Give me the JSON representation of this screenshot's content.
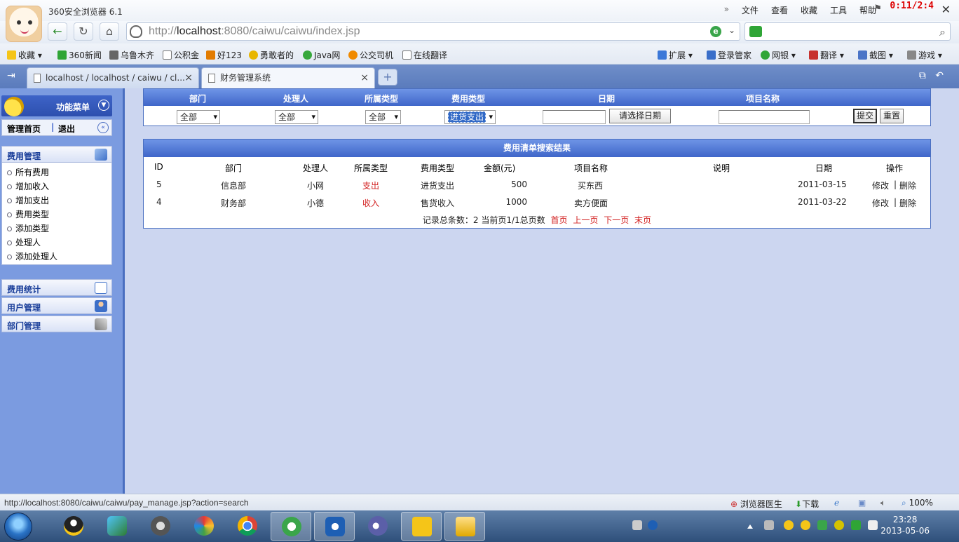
{
  "browser": {
    "app_title": "360安全浏览器 6.1",
    "menu": [
      "文件",
      "查看",
      "收藏",
      "工具",
      "帮助"
    ],
    "clock": "0:11/2:4",
    "url_prefix": "http://",
    "url_host": "localhost",
    "url_rest": ":8080/caiwu/caiwu/index.jsp",
    "favorites_left": [
      "收藏",
      "360新闻",
      "乌鲁木齐",
      "公积金",
      "好123",
      "勇敢者的",
      "Java网",
      "公交司机",
      "在线翻译"
    ],
    "favorites_right": [
      "扩展",
      "登录管家",
      "网银",
      "翻译",
      "截图",
      "游戏"
    ],
    "tabs": [
      {
        "label": "localhost / localhost / caiwu / cl..."
      },
      {
        "label": "财务管理系统"
      }
    ]
  },
  "sidebar": {
    "header": "功能菜单",
    "home": "管理首页",
    "separator": "|",
    "logout": "退出",
    "sections": [
      {
        "title": "费用管理",
        "items": [
          "所有费用",
          "增加收入",
          "增加支出",
          "费用类型",
          "添加类型",
          "处理人",
          "添加处理人"
        ]
      },
      {
        "title": "费用统计"
      },
      {
        "title": "用户管理"
      },
      {
        "title": "部门管理"
      }
    ]
  },
  "search": {
    "headers": [
      "部门",
      "处理人",
      "所属类型",
      "费用类型",
      "日期",
      "项目名称"
    ],
    "dept_value": "全部",
    "handler_value": "全部",
    "category_value": "全部",
    "fee_type_value": "进货支出",
    "date_button": "请选择日期",
    "submit": "提交",
    "reset": "重置"
  },
  "results": {
    "title": "费用清单搜索结果",
    "columns": [
      "ID",
      "部门",
      "处理人",
      "所属类型",
      "费用类型",
      "金额(元)",
      "项目名称",
      "说明",
      "日期",
      "操作"
    ],
    "rows": [
      {
        "id": "5",
        "dept": "信息部",
        "handler": "小网",
        "category": "支出",
        "fee_type": "进货支出",
        "amount": "500",
        "item": "买东西",
        "note": "",
        "date": "2011-03-15",
        "edit": "修改",
        "sep": "|",
        "del": "删除"
      },
      {
        "id": "4",
        "dept": "财务部",
        "handler": "小德",
        "category": "收入",
        "fee_type": "售货收入",
        "amount": "1000",
        "item": "卖方便面",
        "note": "",
        "date": "2011-03-22",
        "edit": "修改",
        "sep": "|",
        "del": "删除"
      }
    ],
    "pager_text": "记录总条数：2 当前页1/1总页数",
    "pager_links": [
      "首页",
      "上一页",
      "下一页",
      "末页"
    ]
  },
  "status": {
    "url": "http://localhost:8080/caiwu/caiwu/pay_manage.jsp?action=search",
    "doctor": "浏览器医生",
    "download": "下载",
    "zoom": "100%"
  },
  "taskbar": {
    "time": "23:28",
    "date": "2013-05-06"
  },
  "colors": {
    "sidebar_bg": "#7b9be0",
    "content_bg": "#ccd6f0",
    "table_header": "#3f66c9",
    "link_red": "#d21f1f"
  }
}
